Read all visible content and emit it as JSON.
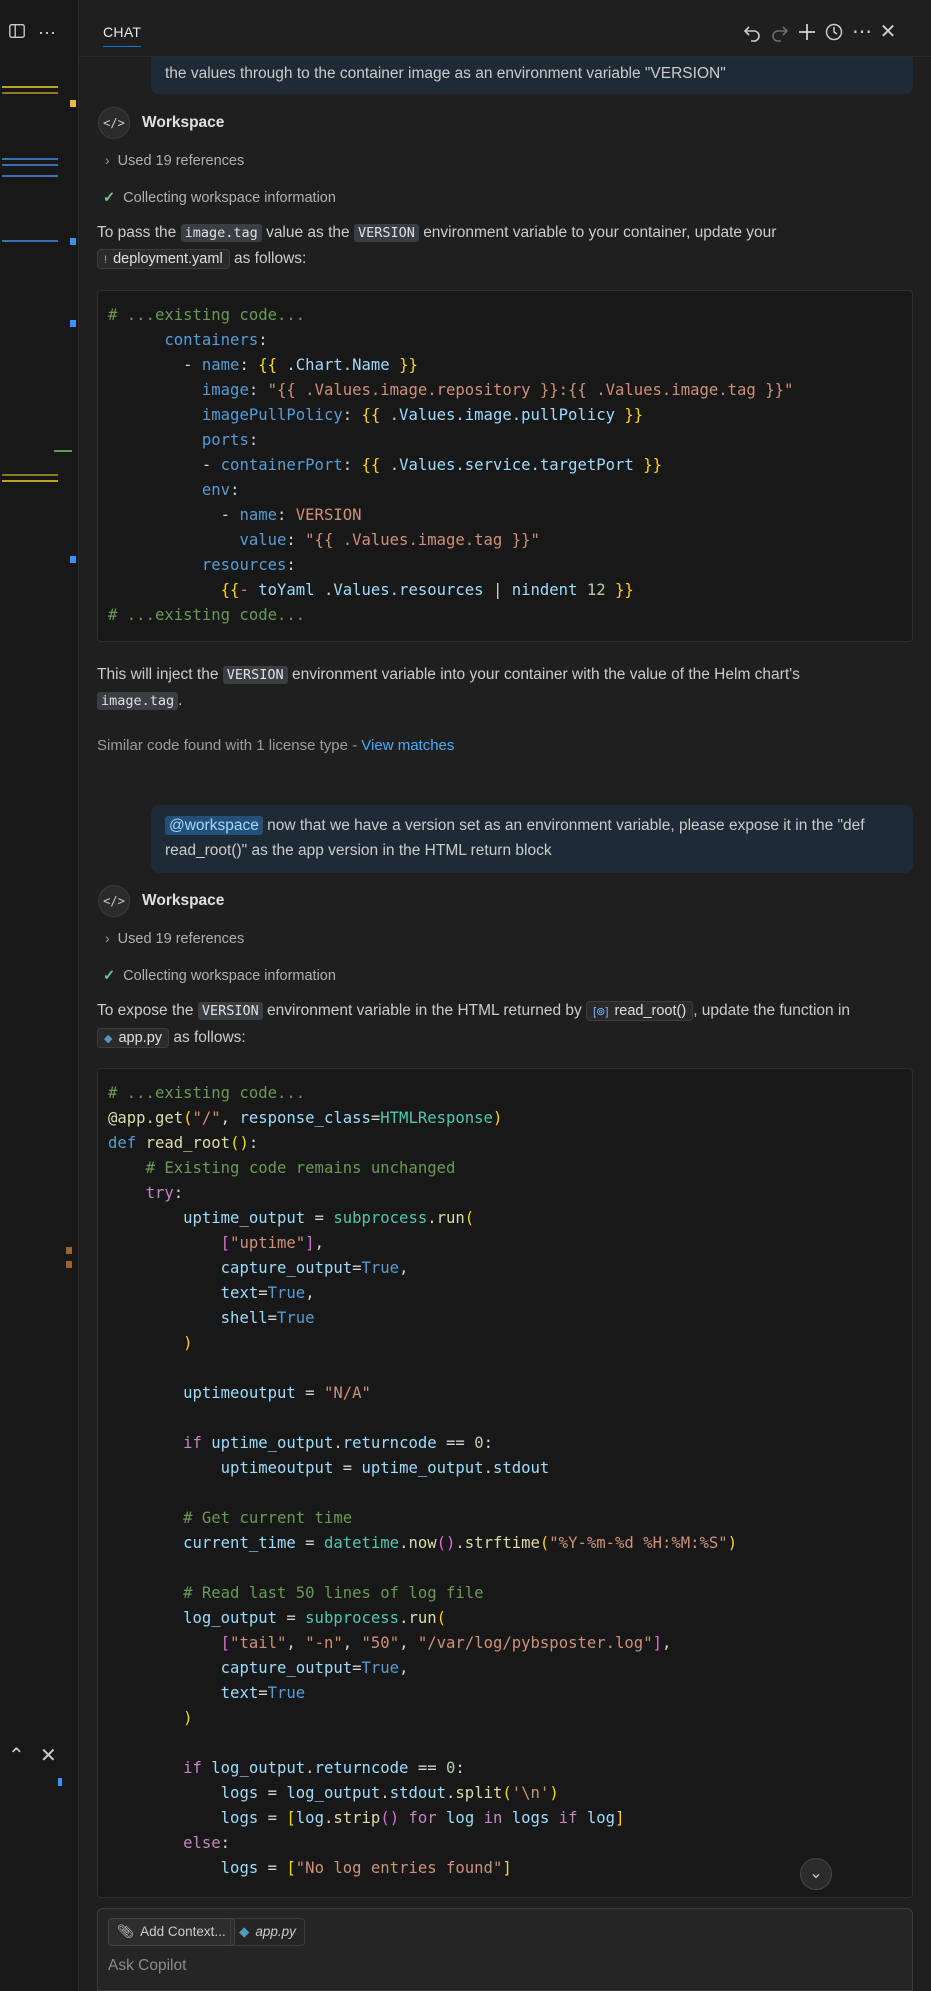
{
  "header": {
    "tab_label": "CHAT"
  },
  "thread": {
    "top_bubble_tail": "the values through to the container image as an environment variable \"VERSION\"",
    "response1": {
      "agent": "Workspace",
      "refs": "Used 19 references",
      "status": "Collecting workspace information",
      "intro_a": "To pass the",
      "intro_code1": "image.tag",
      "intro_b": "value as the",
      "intro_code2": "VERSION",
      "intro_c": "environment variable to your container, update your",
      "file": "deployment.yaml",
      "intro_d": "as follows:",
      "after_a": "This will inject the",
      "after_code1": "VERSION",
      "after_b": "environment variable into your container with the value of the Helm chart's",
      "after_code2": "image.tag",
      "after_c": ".",
      "similar_text": "Similar code found with 1 license type - ",
      "similar_link": "View matches"
    },
    "user2": {
      "mention": "@workspace",
      "text": " now that we have a version set as an environment variable, please expose it in the \"def read_root()\" as the app version in the HTML return block"
    },
    "response2": {
      "agent": "Workspace",
      "refs": "Used 19 references",
      "status": "Collecting workspace information",
      "intro_a": "To expose the",
      "intro_code1": "VERSION",
      "intro_b": "environment variable in the HTML returned by",
      "symbol": "read_root()",
      "intro_c": ", update the function in",
      "file": "app.py",
      "intro_d": "as follows:"
    }
  },
  "composer": {
    "add_context": "Add Context...",
    "context_file": "app.py",
    "placeholder": "Ask Copilot"
  },
  "colors": {
    "accent": "#0078d4",
    "mention_bg": "#264f78",
    "link": "#4daafc"
  }
}
